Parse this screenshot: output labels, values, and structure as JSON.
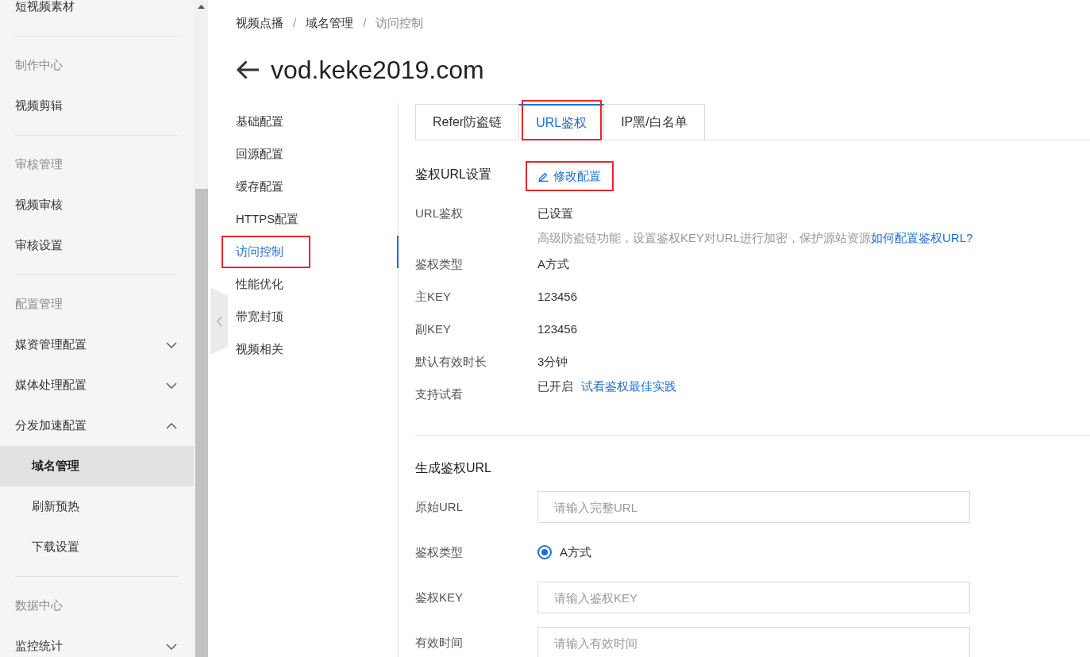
{
  "sidebar": {
    "sections": [
      {
        "items": [
          {
            "kind": "link",
            "label": "短视频素材",
            "selected": false
          }
        ]
      },
      {
        "heading": "制作中心",
        "items": [
          {
            "kind": "link",
            "label": "视频剪辑",
            "selected": false
          }
        ]
      },
      {
        "heading": "审核管理",
        "items": [
          {
            "kind": "link",
            "label": "视频审核",
            "selected": false
          },
          {
            "kind": "link",
            "label": "审核设置",
            "selected": false
          }
        ]
      },
      {
        "heading": "配置管理",
        "items": [
          {
            "kind": "group",
            "label": "媒资管理配置",
            "expanded": false
          },
          {
            "kind": "group",
            "label": "媒体处理配置",
            "expanded": false
          },
          {
            "kind": "group",
            "label": "分发加速配置",
            "expanded": true,
            "children": [
              {
                "kind": "link",
                "label": "域名管理",
                "selected": true
              },
              {
                "kind": "link",
                "label": "刷新预热",
                "selected": false
              },
              {
                "kind": "link",
                "label": "下载设置",
                "selected": false
              }
            ]
          }
        ]
      },
      {
        "heading": "数据中心",
        "items": [
          {
            "kind": "group",
            "label": "监控统计",
            "expanded": false
          }
        ]
      }
    ]
  },
  "breadcrumb": {
    "separator": "/",
    "items": [
      "视频点播",
      "域名管理",
      "访问控制"
    ]
  },
  "header": {
    "title": "vod.keke2019.com"
  },
  "config_nav": {
    "items": [
      {
        "label": "基础配置",
        "selected": false,
        "highlighted": false
      },
      {
        "label": "回源配置",
        "selected": false,
        "highlighted": false
      },
      {
        "label": "缓存配置",
        "selected": false,
        "highlighted": false
      },
      {
        "label": "HTTPS配置",
        "selected": false,
        "highlighted": false
      },
      {
        "label": "访问控制",
        "selected": true,
        "highlighted": true
      },
      {
        "label": "性能优化",
        "selected": false,
        "highlighted": false
      },
      {
        "label": "带宽封顶",
        "selected": false,
        "highlighted": false
      },
      {
        "label": "视频相关",
        "selected": false,
        "highlighted": false
      }
    ]
  },
  "tabs": [
    {
      "label": "Refer防盗链",
      "selected": false,
      "highlighted": false
    },
    {
      "label": "URL鉴权",
      "selected": true,
      "highlighted": true
    },
    {
      "label": "IP黑/白名单",
      "selected": false,
      "highlighted": false
    }
  ],
  "auth_settings": {
    "title": "鉴权URL设置",
    "edit_button": {
      "label": "修改配置",
      "highlighted": true
    },
    "rows": [
      {
        "label": "URL鉴权",
        "value": "已设置",
        "hint": "高级防盗链功能，设置鉴权KEY对URL进行加密，保护源站资源",
        "hint_link": "如何配置鉴权URL?"
      },
      {
        "label": "鉴权类型",
        "value": "A方式"
      },
      {
        "label": "主KEY",
        "value": "123456"
      },
      {
        "label": "副KEY",
        "value": "123456"
      },
      {
        "label": "默认有效时长",
        "value": "3分钟"
      },
      {
        "label": "支持试看",
        "value": "已开启",
        "link": "试看鉴权最佳实践"
      }
    ]
  },
  "generate_url": {
    "title": "生成鉴权URL",
    "fields": [
      {
        "kind": "input",
        "label": "原始URL",
        "placeholder": "请输入完整URL"
      },
      {
        "kind": "radio",
        "label": "鉴权类型",
        "options": [
          {
            "label": "A方式",
            "selected": true
          }
        ]
      },
      {
        "kind": "input",
        "label": "鉴权KEY",
        "placeholder": "请输入鉴权KEY"
      },
      {
        "kind": "input",
        "label": "有效时间",
        "placeholder": "请输入有效时间"
      }
    ]
  }
}
